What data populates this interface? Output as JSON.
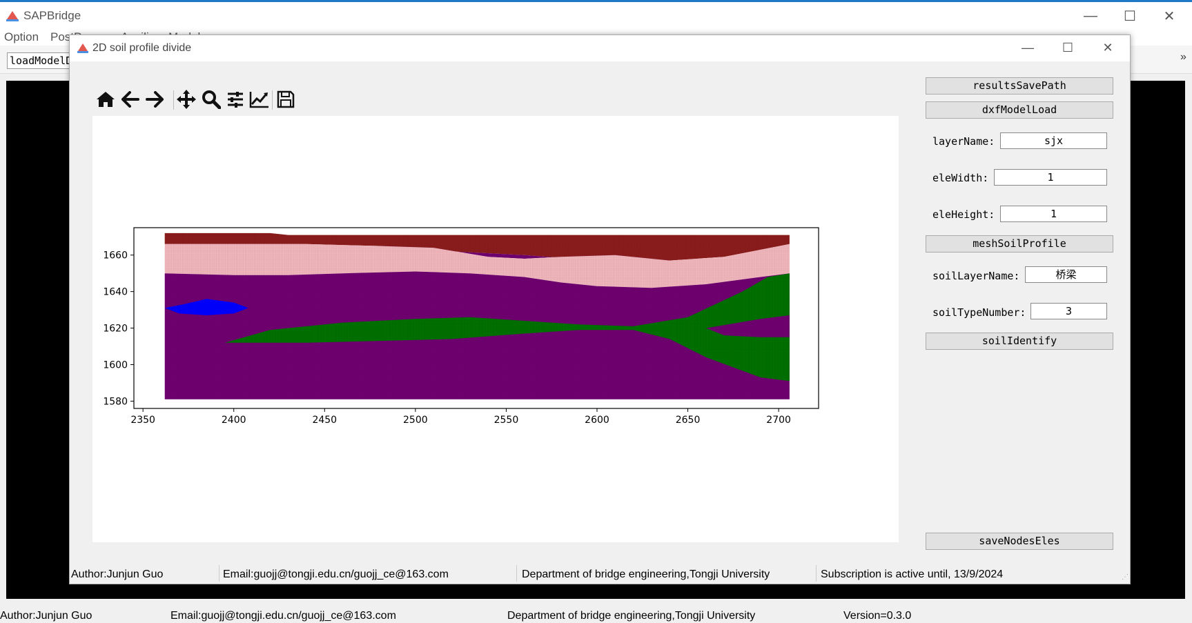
{
  "app": {
    "title": "SAPBridge",
    "menu": [
      "Option",
      "PostP",
      "Auxiliary Model"
    ],
    "toolbar_button": "loadModelD"
  },
  "dialog": {
    "title": "2D soil profile divide",
    "toolbar_icons": [
      "home-icon",
      "back-icon",
      "forward-icon",
      "pan-icon",
      "zoom-icon",
      "configure-subplots-icon",
      "edit-axis-icon",
      "save-icon"
    ],
    "buttons": {
      "results_save_path": "resultsSavePath",
      "dxf_model_load": "dxfModelLoad",
      "mesh_soil_profile": "meshSoilProfile",
      "soil_identify": "soilIdentify",
      "save_nodes_eles": "saveNodesEles"
    },
    "fields": {
      "layer_name": {
        "label": "layerName:",
        "value": "sjx"
      },
      "ele_width": {
        "label": "eleWidth:",
        "value": "1"
      },
      "ele_height": {
        "label": "eleHeight:",
        "value": "1"
      },
      "soil_layer_name": {
        "label": "soilLayerName:",
        "value": "桥梁"
      },
      "soil_type_number": {
        "label": "soilTypeNumber:",
        "value": "3"
      }
    },
    "status": {
      "author": "Author:Junjun Guo",
      "email": "Email:guojj@tongji.edu.cn/guojj_ce@163.com",
      "dept": "Department of bridge engineering,Tongji University",
      "subscription": "Subscription is active until, 13/9/2024"
    }
  },
  "status": {
    "author": "Author:Junjun Guo",
    "email": "Email:guojj@tongji.edu.cn/guojj_ce@163.com",
    "dept": "Department of bridge engineering,Tongji University",
    "version": "Version=0.3.0"
  },
  "colors": {
    "top_layer": "#8b1c1c",
    "pink_layer": "#f0b6bc",
    "purple_layer": "#6f006f",
    "green_layer": "#007000",
    "blue_lens": "#0000ff"
  },
  "chart_data": {
    "type": "area",
    "xlim": [
      2345,
      2722
    ],
    "ylim": [
      1576,
      1675
    ],
    "xticks": [
      2350,
      2400,
      2450,
      2500,
      2550,
      2600,
      2650,
      2700
    ],
    "yticks": [
      1580,
      1600,
      1620,
      1640,
      1660
    ],
    "x_range_of_mesh": [
      2362,
      2706
    ],
    "y_bottom_of_mesh": 1581,
    "regions": [
      {
        "name": "top layer",
        "color": "#8b1c1c",
        "top": [
          [
            2362,
            1672
          ],
          [
            2420,
            1672
          ],
          [
            2430,
            1671
          ],
          [
            2706,
            1671
          ]
        ],
        "bottom": [
          [
            2362,
            1666
          ],
          [
            2440,
            1666
          ],
          [
            2480,
            1665
          ],
          [
            2520,
            1662
          ],
          [
            2560,
            1660
          ],
          [
            2600,
            1657
          ],
          [
            2640,
            1657
          ],
          [
            2670,
            1659
          ],
          [
            2706,
            1666
          ]
        ]
      },
      {
        "name": "purple upper lens",
        "color": "#6f006f",
        "top": [
          [
            2480,
            1665
          ],
          [
            2520,
            1662
          ],
          [
            2560,
            1660
          ],
          [
            2600,
            1657
          ],
          [
            2640,
            1657
          ]
        ],
        "bottom": [
          [
            2480,
            1665
          ],
          [
            2510,
            1664
          ],
          [
            2540,
            1659
          ],
          [
            2560,
            1658
          ],
          [
            2580,
            1659
          ],
          [
            2610,
            1660
          ],
          [
            2640,
            1657
          ]
        ]
      },
      {
        "name": "pink layer",
        "color": "#f0b6bc",
        "top": [
          [
            2362,
            1666
          ],
          [
            2440,
            1666
          ],
          [
            2480,
            1665
          ],
          [
            2510,
            1664
          ],
          [
            2540,
            1659
          ],
          [
            2560,
            1658
          ],
          [
            2580,
            1659
          ],
          [
            2610,
            1660
          ],
          [
            2640,
            1657
          ],
          [
            2670,
            1659
          ],
          [
            2706,
            1666
          ]
        ],
        "bottom": [
          [
            2362,
            1650
          ],
          [
            2400,
            1649
          ],
          [
            2430,
            1649
          ],
          [
            2460,
            1650
          ],
          [
            2500,
            1651
          ],
          [
            2530,
            1650
          ],
          [
            2560,
            1648
          ],
          [
            2580,
            1645
          ],
          [
            2600,
            1643
          ],
          [
            2630,
            1642
          ],
          [
            2660,
            1644
          ],
          [
            2690,
            1648
          ],
          [
            2706,
            1650
          ]
        ]
      },
      {
        "name": "purple main",
        "color": "#6f006f",
        "top": [
          [
            2362,
            1650
          ],
          [
            2400,
            1649
          ],
          [
            2430,
            1649
          ],
          [
            2460,
            1650
          ],
          [
            2500,
            1651
          ],
          [
            2530,
            1650
          ],
          [
            2560,
            1648
          ],
          [
            2580,
            1645
          ],
          [
            2600,
            1643
          ],
          [
            2630,
            1642
          ],
          [
            2660,
            1644
          ],
          [
            2690,
            1648
          ],
          [
            2706,
            1650
          ]
        ],
        "bottom": [
          [
            2362,
            1581
          ],
          [
            2706,
            1581
          ]
        ]
      },
      {
        "name": "green layer",
        "color": "#007000",
        "points": [
          [
            2395,
            1612
          ],
          [
            2420,
            1619
          ],
          [
            2460,
            1623
          ],
          [
            2500,
            1625
          ],
          [
            2530,
            1626
          ],
          [
            2560,
            1624
          ],
          [
            2590,
            1622
          ],
          [
            2620,
            1621
          ],
          [
            2650,
            1626
          ],
          [
            2680,
            1640
          ],
          [
            2694,
            1648
          ],
          [
            2706,
            1650
          ],
          [
            2706,
            1591
          ],
          [
            2690,
            1593
          ],
          [
            2660,
            1604
          ],
          [
            2640,
            1614
          ],
          [
            2620,
            1619
          ],
          [
            2590,
            1619
          ],
          [
            2560,
            1617
          ],
          [
            2520,
            1614
          ],
          [
            2480,
            1613
          ],
          [
            2440,
            1612
          ],
          [
            2400,
            1612
          ]
        ]
      },
      {
        "name": "purple inner lens",
        "color": "#6f006f",
        "points": [
          [
            2660,
            1620
          ],
          [
            2690,
            1625
          ],
          [
            2706,
            1627
          ],
          [
            2706,
            1615
          ],
          [
            2690,
            1615
          ],
          [
            2670,
            1616
          ]
        ]
      },
      {
        "name": "blue lens",
        "color": "#0000ff",
        "points": [
          [
            2362,
            1631
          ],
          [
            2372,
            1633
          ],
          [
            2385,
            1636
          ],
          [
            2400,
            1634
          ],
          [
            2408,
            1631
          ],
          [
            2400,
            1628
          ],
          [
            2385,
            1627
          ],
          [
            2370,
            1628
          ]
        ]
      }
    ]
  }
}
